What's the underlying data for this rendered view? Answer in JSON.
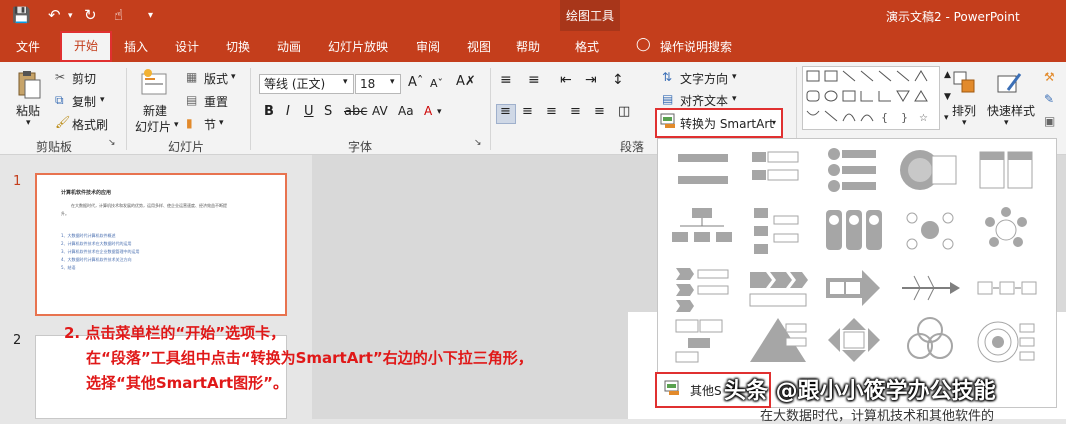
{
  "title_bar": {
    "context_group": "绘图工具",
    "document_title": "演示文稿2 - PowerPoint"
  },
  "tabs": [
    "文件",
    "开始",
    "插入",
    "设计",
    "切换",
    "动画",
    "幻灯片放映",
    "审阅",
    "视图",
    "帮助",
    "格式"
  ],
  "tell_me": "操作说明搜索",
  "clipboard": {
    "paste": "粘贴",
    "cut": "剪切",
    "copy": "复制",
    "format_painter": "格式刷",
    "group": "剪贴板"
  },
  "slides_group": {
    "new_slide_1": "新建",
    "new_slide_2": "幻灯片",
    "layout": "版式",
    "reset": "重置",
    "section": "节",
    "group": "幻灯片"
  },
  "font_group": {
    "font_name": "等线 (正文)",
    "font_size": "18",
    "group": "字体"
  },
  "paragraph_group": {
    "text_direction": "文字方向",
    "align_text": "对齐文本",
    "convert_smartart": "转换为 SmartArt",
    "group": "段落"
  },
  "drawing_group": {
    "arrange": "排列",
    "quick_styles": "快速样式"
  },
  "more_smartart": "其他S",
  "slides": {
    "num1": "1",
    "num2": "2",
    "title": "计算机软件技术的应用",
    "para1": "在大数据时代，计算机技术和发展的优势，运用多样、使企业运营速度、经济效益不断提",
    "para2": "升。",
    "items": [
      "1、大数据时代计算机软件概述",
      "2、计算机软件技术在大数据时代的运用",
      "3、计算机软件技术在企业数据管理中的运用",
      "4、大数据时代计算机软件技术关注方向",
      "5、结语"
    ]
  },
  "annotation": {
    "line1": "2. 点击菜单栏的“开始”选项卡，",
    "line2": "在“段落”工具组中点击“转换为SmartArt”右边的小下拉三角形，",
    "line3": "选择“其他SmartArt图形”。"
  },
  "watermark": "头条 @跟小小筱学办公技能",
  "bottom_text": "在大数据时代，计算机技术和其他软件的"
}
